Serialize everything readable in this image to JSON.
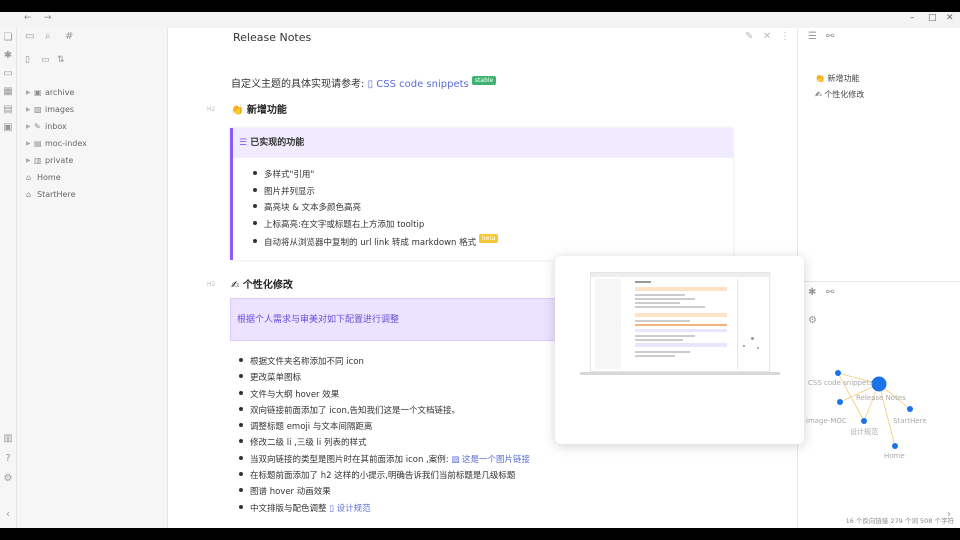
{
  "window": {
    "nav": [
      "←",
      "→"
    ],
    "controls": [
      "–",
      "□",
      "✕"
    ]
  },
  "sidebar": {
    "items": [
      {
        "label": "archive",
        "icon": "folder-icon",
        "expandable": true
      },
      {
        "label": "images",
        "icon": "image-icon",
        "expandable": true
      },
      {
        "label": "inbox",
        "icon": "inbox-icon",
        "expandable": true
      },
      {
        "label": "moc-index",
        "icon": "index-icon",
        "expandable": true
      },
      {
        "label": "private",
        "icon": "lock-icon",
        "expandable": true
      },
      {
        "label": "Home",
        "icon": "home-icon",
        "expandable": false
      },
      {
        "label": "StartHere",
        "icon": "home-icon",
        "expandable": false
      }
    ]
  },
  "editor": {
    "title": "Release Notes",
    "intro_text": "自定义主题的具体实现请参考:",
    "intro_link": "CSS code snippets",
    "intro_tag": "stable",
    "section1_heading": "👏 新增功能",
    "callout1_title": "已实现的功能",
    "callout1_items": [
      "多样式\"引用\"",
      "图片并列显示",
      "高亮块 & 文本多颜色高亮",
      "上标高亮:在文字或标题右上方添加 tooltip",
      "自动将从浏览器中复制的 url link 转成 markdown 格式"
    ],
    "callout1_item5_tag": "beta",
    "section2_heading": "✍ 个性化修改",
    "callout2_text": "根据个人需求与审美对如下配置进行调整",
    "list2_items": [
      "根据文件夹名称添加不同 icon",
      "更改菜单图标",
      "文件与大纲 hover 效果",
      "双向链接前面添加了 icon,告知我们这是一个文档链接。",
      "调整标题 emoji 与文本间隔距离",
      "修改二级 li ,三级 li 列表的样式",
      "当双向链接的类型是图片时在其前面添加 icon ,案例:",
      "在标题前面添加了 h2 这样的小提示,明确告诉我们当前标题是几级标题",
      "图谱 hover 动画效果",
      "中文排版与配色调整"
    ],
    "list2_item7_link": "这是一个图片链接",
    "list2_item10_link": "设计规范",
    "heading_hint": "H2"
  },
  "outline": {
    "items": [
      "👏 新增功能",
      "✍ 个性化修改"
    ]
  },
  "graph": {
    "nodes": [
      "CSS code snippets",
      "Release Notes",
      "image-MOC",
      "设计规范",
      "StartHere",
      "Home"
    ]
  },
  "status": {
    "text": "16 个反向链接   279 个词   508 个字符"
  },
  "colors": {
    "accent": "#8b5cf6",
    "link": "#5b6dd6",
    "graph_node": "#1a73e8"
  }
}
